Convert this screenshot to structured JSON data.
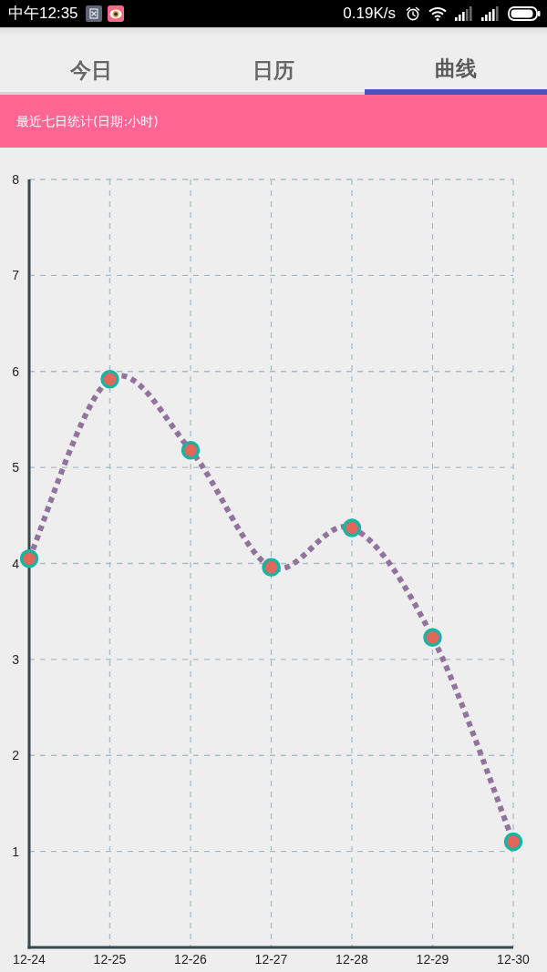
{
  "status_bar": {
    "time": "中午12:35",
    "network_speed": "0.19K/s"
  },
  "tabs": [
    {
      "label": "今日",
      "selected": false
    },
    {
      "label": "日历",
      "selected": false
    },
    {
      "label": "曲线",
      "selected": true
    }
  ],
  "chart": {
    "chart_data": {
      "type": "line",
      "title": "最近七日统计(日期:小时)",
      "categories": [
        "12-24",
        "12-25",
        "12-26",
        "12-27",
        "12-28",
        "12-29",
        "12-30"
      ],
      "series": [
        {
          "color": "#92739d",
          "line_style": "dotted",
          "marker": "circle",
          "values": [
            4.05,
            5.92,
            5.18,
            3.96,
            4.37,
            3.23,
            1.1
          ]
        }
      ],
      "ylim": [
        0,
        8
      ],
      "yticks": [
        1,
        2,
        3,
        4,
        5,
        6,
        7,
        8
      ],
      "grid": true
    }
  }
}
